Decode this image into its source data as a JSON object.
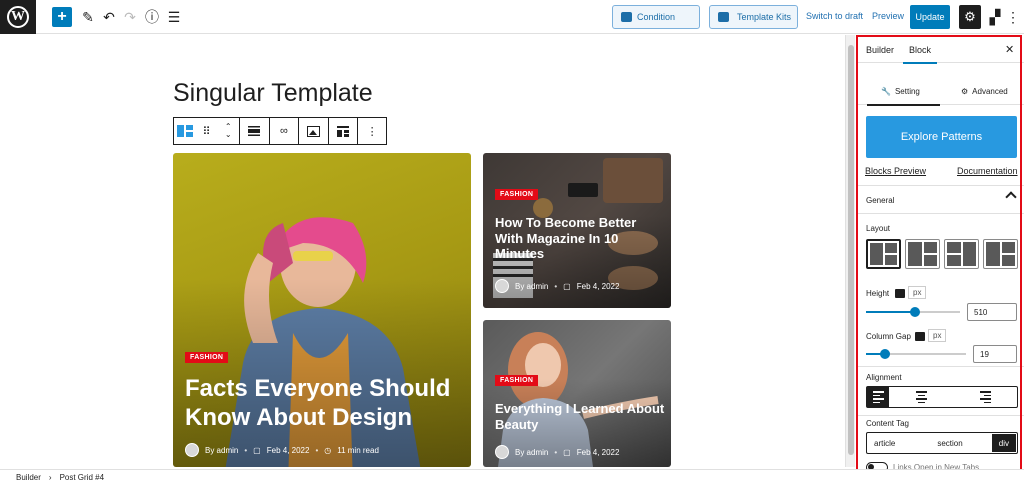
{
  "topbar": {
    "condition_label": "Condition",
    "template_kits_label": "Template Kits",
    "switch_to_draft_label": "Switch to draft",
    "preview_label": "Preview",
    "update_label": "Update"
  },
  "editor": {
    "page_title": "Singular Template"
  },
  "posts": [
    {
      "category": "FASHION",
      "title": "Facts Everyone Should Know About Design",
      "author": "By admin",
      "date": "Feb 4, 2022",
      "read_time": "11 min read"
    },
    {
      "category": "FASHION",
      "title": "How To Become Better With Magazine In 10 Minutes",
      "author": "By admin",
      "date": "Feb 4, 2022"
    },
    {
      "category": "FASHION",
      "title": "Everything I Learned About Beauty",
      "author": "By admin",
      "date": "Feb 4, 2022"
    }
  ],
  "sidebar": {
    "tabs": [
      "Builder",
      "Block"
    ],
    "sub_tabs": [
      "Setting",
      "Advanced"
    ],
    "explore_label": "Explore Patterns",
    "blocks_preview_label": "Blocks Preview",
    "documentation_label": "Documentation",
    "general_label": "General",
    "layout_label": "Layout",
    "height_label": "Height",
    "height_unit": "px",
    "height_value": "510",
    "column_gap_label": "Column Gap",
    "column_gap_unit": "px",
    "column_gap_value": "19",
    "alignment_label": "Alignment",
    "content_tag_label": "Content Tag",
    "content_tags": [
      "article",
      "section",
      "div"
    ],
    "links_new_tab_label": "Links Open in New Tabs"
  },
  "footer": {
    "crumb_1": "Builder",
    "crumb_2": "Post Grid #4"
  },
  "colors": {
    "accent": "#007cba",
    "badge": "#e30b17",
    "explore": "#2899e0",
    "highlight": "#e30b17"
  }
}
